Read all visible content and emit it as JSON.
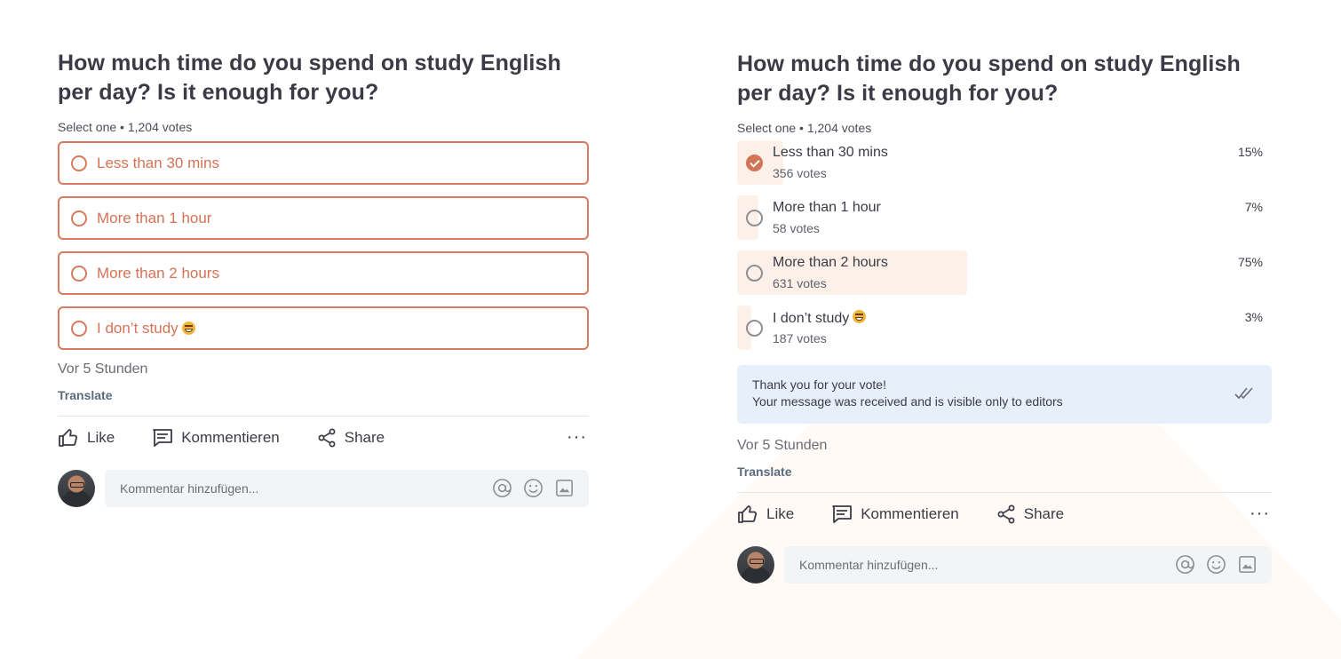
{
  "question": "How much time do you spend on study English per day? Is it enough for you?",
  "meta": "Select one • 1,204 votes",
  "options": [
    {
      "label": "Less than 30 mins",
      "emoji": false
    },
    {
      "label": "More than 1 hour",
      "emoji": false
    },
    {
      "label": "More than 2 hours",
      "emoji": false
    },
    {
      "label": "I don’t study",
      "emoji": true
    }
  ],
  "results": [
    {
      "label": "Less than 30 mins",
      "votes": "356 votes",
      "percent": "15%",
      "fraction": 0.15,
      "selected": true
    },
    {
      "label": "More than 1 hour",
      "votes": "58 votes",
      "percent": "7%",
      "fraction": 0.07,
      "selected": false
    },
    {
      "label": "More than 2 hours",
      "votes": "631 votes",
      "percent": "75%",
      "fraction": 0.75,
      "selected": false
    },
    {
      "label": "I don’t study",
      "votes": "187 votes",
      "percent": "3%",
      "fraction": 0.03,
      "selected": false
    }
  ],
  "thanks": {
    "title": "Thank you for your vote!",
    "message": "Your message was received and is visible only to editors"
  },
  "timestamp": "Vor 5 Stunden",
  "translate": "Translate",
  "actions": {
    "like": "Like",
    "comment": "Kommentieren",
    "share": "Share",
    "more": "···"
  },
  "comment": {
    "placeholder": "Kommentar hinzufügen..."
  },
  "icons": [
    "thumbs-up-icon",
    "comment-icon",
    "share-icon",
    "more-icon",
    "at-icon",
    "emoji-icon",
    "image-icon",
    "double-check-icon",
    "radio-icon",
    "check-icon"
  ],
  "colors": {
    "accent": "#d77a5f",
    "result_fill": "#fdf0e9",
    "notice_bg": "#e7effb"
  }
}
